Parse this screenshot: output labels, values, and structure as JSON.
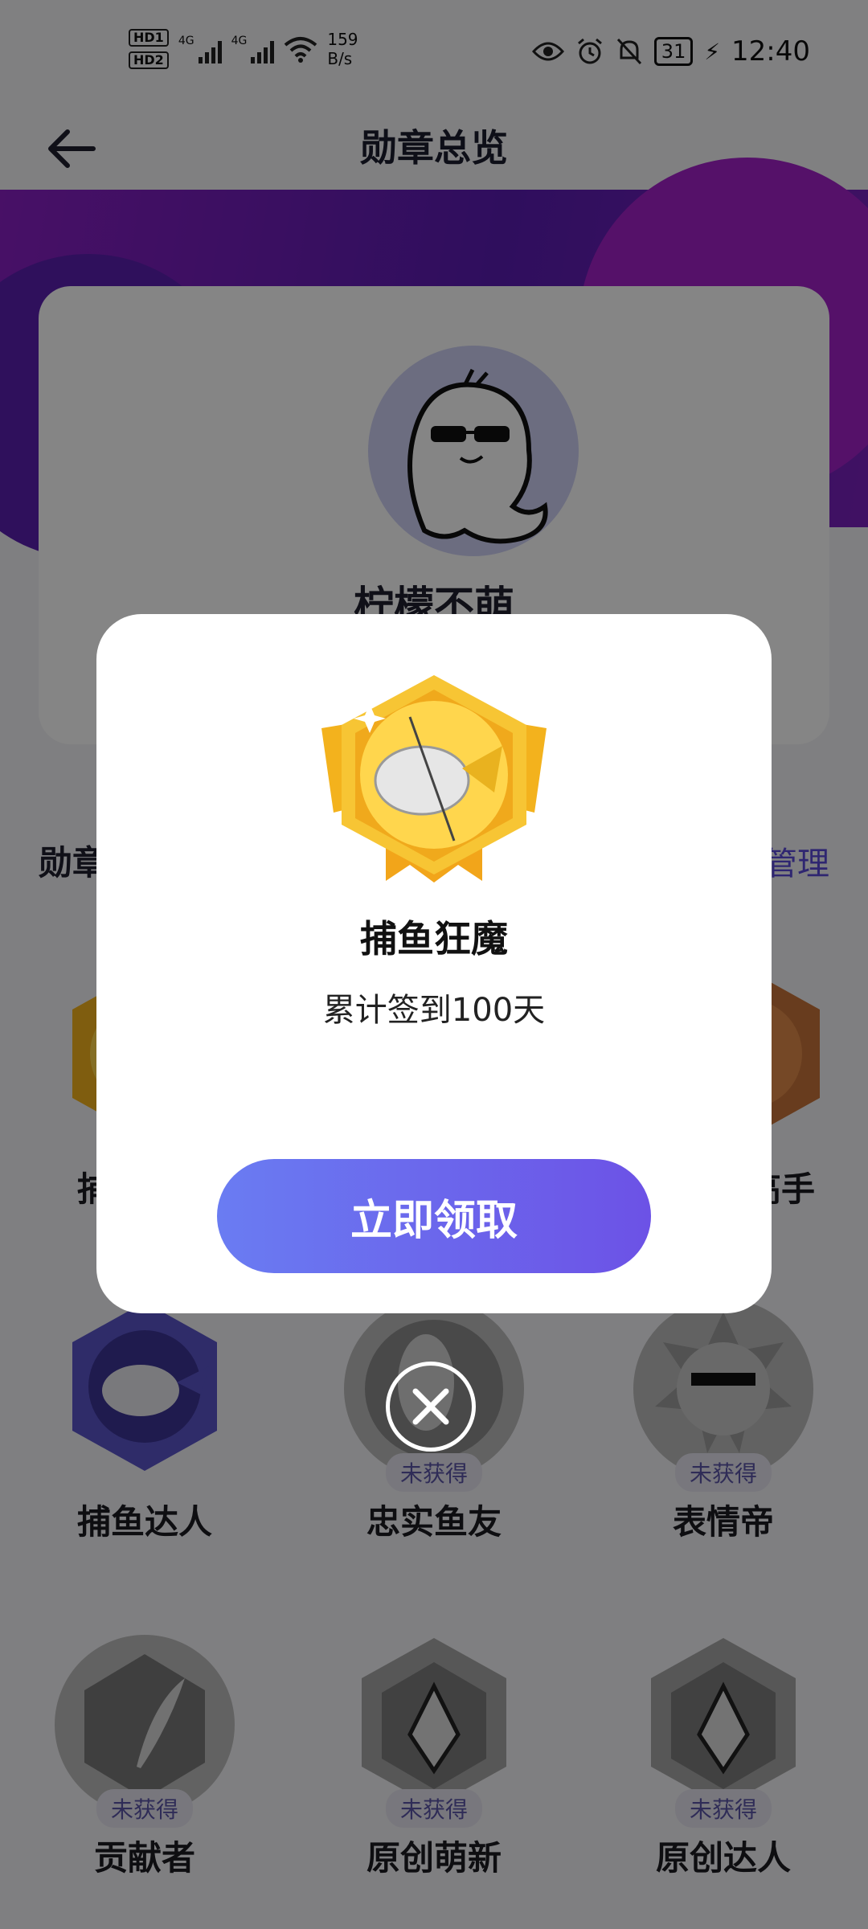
{
  "status_bar": {
    "hd1": "HD1",
    "hd2": "HD2",
    "net1": "4G",
    "net2": "4G",
    "speed_value": "159",
    "speed_unit": "B/s",
    "battery": "31",
    "time": "12:40"
  },
  "header": {
    "title": "勋章总览"
  },
  "profile": {
    "username": "柠檬不萌"
  },
  "section": {
    "title": "勋章",
    "manage": "管理"
  },
  "badges": [
    {
      "name": "捕鱼狂魔",
      "status": "",
      "style": "gold"
    },
    {
      "name": "",
      "status": "",
      "style": "hidden"
    },
    {
      "name": "捕鱼高手",
      "status": "",
      "style": "bronze"
    },
    {
      "name": "捕鱼达人",
      "status": "",
      "style": "purple"
    },
    {
      "name": "忠实鱼友",
      "status": "未获得",
      "style": "grey"
    },
    {
      "name": "表情帝",
      "status": "未获得",
      "style": "grey"
    },
    {
      "name": "贡献者",
      "status": "未获得",
      "style": "grey"
    },
    {
      "name": "原创萌新",
      "status": "未获得",
      "style": "grey"
    },
    {
      "name": "原创达人",
      "status": "未获得",
      "style": "grey"
    }
  ],
  "dialog": {
    "medal_name": "捕鱼狂魔",
    "description": "累计签到100天",
    "button_label": "立即领取"
  },
  "icons": {
    "back": "arrow-left-icon",
    "close": "close-circle-icon"
  },
  "colors": {
    "accent_purple": "#6c52e6",
    "button_start": "#6a7cf2",
    "hero": "#6b1fbb",
    "gold": "#f3b21d"
  }
}
